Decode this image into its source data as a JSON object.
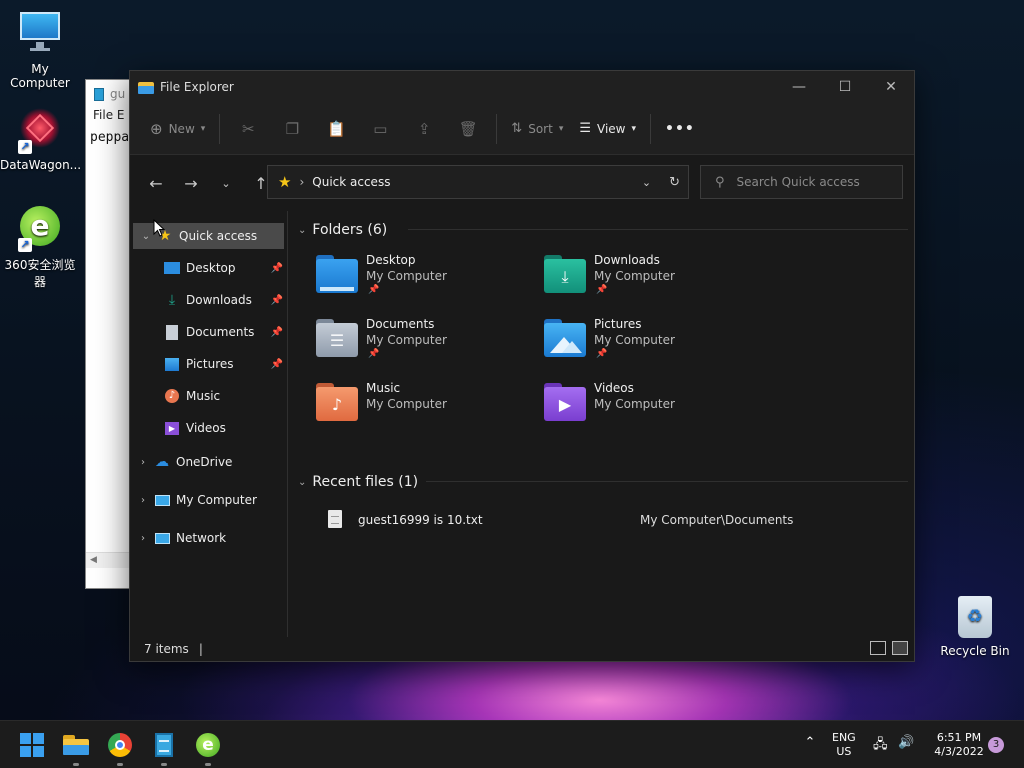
{
  "desktop": {
    "icons": [
      {
        "label": "My Computer"
      },
      {
        "label": "DataWagon..."
      },
      {
        "label": "360安全浏览器"
      }
    ],
    "recycle_bin": {
      "label": "Recycle Bin"
    }
  },
  "bg_window": {
    "title": "gu",
    "menu": "File  E",
    "content": "peppa"
  },
  "explorer": {
    "title": "File Explorer",
    "toolbar": {
      "new_label": "New",
      "sort_label": "Sort",
      "view_label": "View",
      "more_label": "•••"
    },
    "address": {
      "crumb": "Quick access"
    },
    "search": {
      "placeholder": "Search Quick access"
    },
    "sidebar": {
      "quick_access": "Quick access",
      "items": [
        {
          "label": "Desktop"
        },
        {
          "label": "Downloads"
        },
        {
          "label": "Documents"
        },
        {
          "label": "Pictures"
        },
        {
          "label": "Music"
        },
        {
          "label": "Videos"
        }
      ],
      "onedrive": "OneDrive",
      "my_computer": "My Computer",
      "network": "Network"
    },
    "folders": {
      "heading": "Folders (6)",
      "items": [
        {
          "name": "Desktop",
          "location": "My Computer",
          "color": "#2b8de0"
        },
        {
          "name": "Downloads",
          "location": "My Computer",
          "color": "#1ea48b"
        },
        {
          "name": "Documents",
          "location": "My Computer",
          "color": "#9aa6b5"
        },
        {
          "name": "Pictures",
          "location": "My Computer",
          "color": "#2f9ae8"
        },
        {
          "name": "Music",
          "location": "My Computer",
          "color": "#e8764f"
        },
        {
          "name": "Videos",
          "location": "My Computer",
          "color": "#8a4fd8"
        }
      ]
    },
    "recent": {
      "heading": "Recent files (1)",
      "files": [
        {
          "name": "guest16999 is 10.txt",
          "path": "My Computer\\Documents"
        }
      ]
    },
    "status": {
      "items": "7 items"
    }
  },
  "taskbar": {
    "lang_top": "ENG",
    "lang_bottom": "US",
    "time": "6:51 PM",
    "date": "4/3/2022",
    "notifications": "3"
  }
}
